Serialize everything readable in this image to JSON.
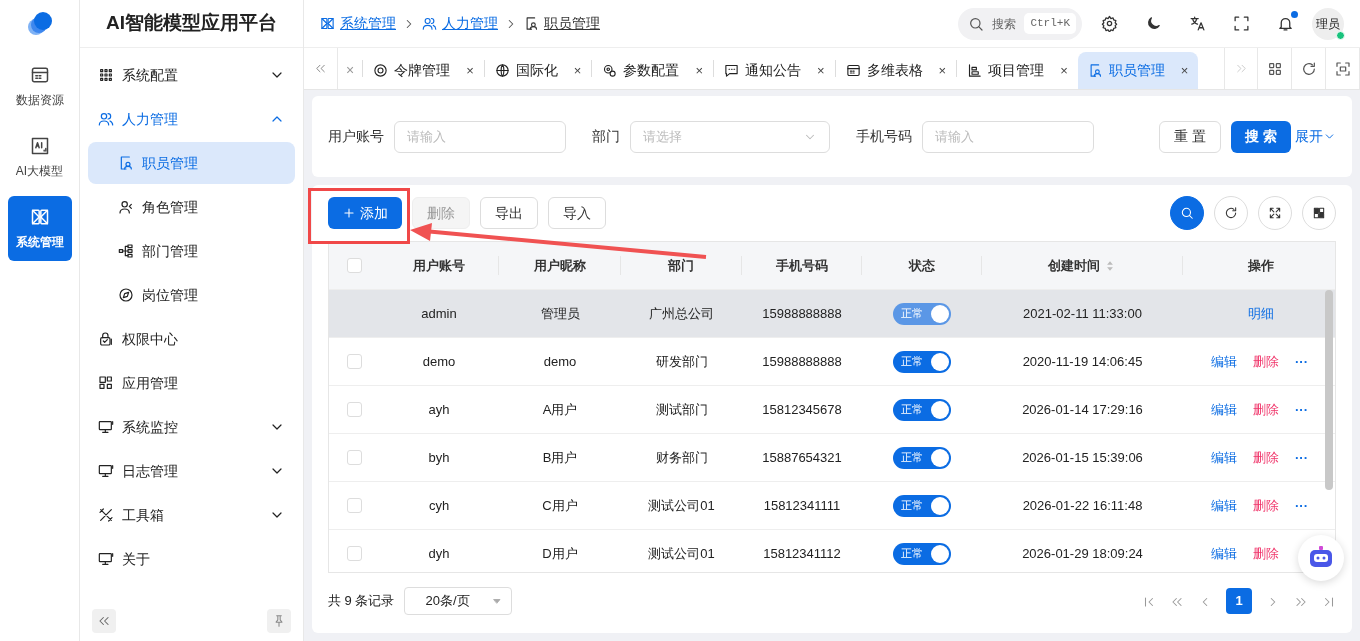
{
  "brand": {
    "title": "AI智能模型应用平台"
  },
  "rail": [
    {
      "label": "数据资源",
      "selected": false
    },
    {
      "label": "AI大模型",
      "selected": false
    },
    {
      "label": "系统管理",
      "selected": true
    }
  ],
  "sidebar": [
    {
      "label": "系统配置",
      "expandable": true,
      "expanded": false,
      "selected": false
    },
    {
      "label": "人力管理",
      "expandable": true,
      "expanded": true,
      "selected": false,
      "children": [
        {
          "label": "职员管理",
          "selected": true
        },
        {
          "label": "角色管理",
          "selected": false
        },
        {
          "label": "部门管理",
          "selected": false
        },
        {
          "label": "岗位管理",
          "selected": false
        }
      ]
    },
    {
      "label": "权限中心",
      "expandable": false,
      "selected": false
    },
    {
      "label": "应用管理",
      "expandable": false,
      "selected": false
    },
    {
      "label": "系统监控",
      "expandable": true,
      "expanded": false,
      "selected": false
    },
    {
      "label": "日志管理",
      "expandable": true,
      "expanded": false,
      "selected": false
    },
    {
      "label": "工具箱",
      "expandable": true,
      "expanded": false,
      "selected": false
    },
    {
      "label": "关于",
      "expandable": false,
      "selected": false
    }
  ],
  "breadcrumb": [
    {
      "label": "系统管理",
      "current": false
    },
    {
      "label": "人力管理",
      "current": false
    },
    {
      "label": "职员管理",
      "current": true
    }
  ],
  "header": {
    "search_placeholder": "搜索",
    "shortcut": "Ctrl+K",
    "avatar": "理员",
    "unread": true,
    "online": true
  },
  "tabs": [
    {
      "kind": "clipped",
      "close": "×",
      "selected": false
    },
    {
      "kind": "tab",
      "label": "令牌管理",
      "close": "×",
      "selected": false
    },
    {
      "kind": "tab",
      "label": "国际化",
      "close": "×",
      "selected": false
    },
    {
      "kind": "tab",
      "label": "参数配置",
      "close": "×",
      "selected": false
    },
    {
      "kind": "tab",
      "label": "通知公告",
      "close": "×",
      "selected": false
    },
    {
      "kind": "tab",
      "label": "多维表格",
      "close": "×",
      "selected": false
    },
    {
      "kind": "tab",
      "label": "项目管理",
      "close": "×",
      "selected": false
    },
    {
      "kind": "tab",
      "label": "职员管理",
      "close": "×",
      "selected": true
    }
  ],
  "filters": [
    {
      "label": "用户账号",
      "kind": "input",
      "placeholder": "请输入"
    },
    {
      "label": "部门",
      "kind": "select",
      "placeholder": "请选择"
    },
    {
      "label": "手机号码",
      "kind": "input",
      "placeholder": "请输入"
    }
  ],
  "filter_buttons": {
    "reset": "重 置",
    "search": "搜 索",
    "expand": "展开"
  },
  "toolbar": [
    {
      "label": "添加",
      "kind": "primary",
      "disabled": false
    },
    {
      "label": "删除",
      "kind": "default",
      "disabled": true
    },
    {
      "label": "导出",
      "kind": "default",
      "disabled": false
    },
    {
      "label": "导入",
      "kind": "default",
      "disabled": false
    }
  ],
  "table": {
    "select_all_checked": false,
    "columns": [
      "用户账号",
      "用户昵称",
      "部门",
      "手机号码",
      "状态",
      "创建时间",
      "操作"
    ],
    "rows": [
      {
        "kind": "admin",
        "cells": [
          "admin",
          "管理员",
          "广州总公司",
          "15988888888"
        ],
        "status": "正常",
        "on": true,
        "created": "2021-02-11 11:33:00",
        "highlighted": true,
        "actions": [
          {
            "label": "明细",
            "kind": "link"
          }
        ]
      },
      {
        "kind": "user",
        "checked": false,
        "cells": [
          "demo",
          "demo",
          "研发部门",
          "15988888888"
        ],
        "status": "正常",
        "on": true,
        "created": "2020-11-19 14:06:45",
        "highlighted": false,
        "actions": [
          {
            "label": "编辑",
            "kind": "link"
          },
          {
            "label": "删除",
            "kind": "danger"
          },
          {
            "label": "···",
            "kind": "more"
          }
        ]
      },
      {
        "kind": "user",
        "checked": false,
        "cells": [
          "ayh",
          "A用户",
          "测试部门",
          "15812345678"
        ],
        "status": "正常",
        "on": true,
        "created": "2026-01-14 17:29:16",
        "highlighted": false,
        "actions": [
          {
            "label": "编辑",
            "kind": "link"
          },
          {
            "label": "删除",
            "kind": "danger"
          },
          {
            "label": "···",
            "kind": "more"
          }
        ]
      },
      {
        "kind": "user",
        "checked": false,
        "cells": [
          "byh",
          "B用户",
          "财务部门",
          "15887654321"
        ],
        "status": "正常",
        "on": true,
        "created": "2026-01-15 15:39:06",
        "highlighted": false,
        "actions": [
          {
            "label": "编辑",
            "kind": "link"
          },
          {
            "label": "删除",
            "kind": "danger"
          },
          {
            "label": "···",
            "kind": "more"
          }
        ]
      },
      {
        "kind": "user",
        "checked": false,
        "cells": [
          "cyh",
          "C用户",
          "测试公司01",
          "15812341111"
        ],
        "status": "正常",
        "on": true,
        "created": "2026-01-22 16:11:48",
        "highlighted": false,
        "actions": [
          {
            "label": "编辑",
            "kind": "link"
          },
          {
            "label": "删除",
            "kind": "danger"
          },
          {
            "label": "···",
            "kind": "more"
          }
        ]
      },
      {
        "kind": "user",
        "checked": false,
        "cells": [
          "dyh",
          "D用户",
          "测试公司01",
          "15812341112"
        ],
        "status": "正常",
        "on": true,
        "created": "2026-01-29 18:09:24",
        "highlighted": false,
        "actions": [
          {
            "label": "编辑",
            "kind": "link"
          },
          {
            "label": "删除",
            "kind": "danger"
          }
        ]
      }
    ]
  },
  "footer": {
    "total": "共 9 条记录",
    "page_size": "20条/页",
    "pages": [
      {
        "label": "1",
        "selected": true
      }
    ]
  }
}
